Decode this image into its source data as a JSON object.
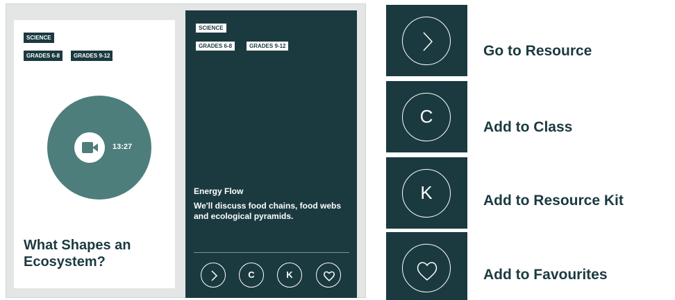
{
  "front_card": {
    "tags": {
      "subject": "SCIENCE",
      "grade_a": "GRADES 6-8",
      "grade_b": "GRADES 9-12"
    },
    "media_icon": "video-camera-icon",
    "duration": "13:27",
    "title": "What Shapes an Ecosystem?"
  },
  "back_card": {
    "tags": {
      "subject": "SCIENCE",
      "grade_a": "GRADES 6-8",
      "grade_b": "GRADES 9-12"
    },
    "title": "Energy Flow",
    "description": "We'll discuss food chains, food webs and ecological pyramids.",
    "actions": {
      "go": "chevron-right-icon",
      "class": "C",
      "kit": "K",
      "favourite": "heart-icon"
    }
  },
  "legend": {
    "items": [
      {
        "icon": "chevron-right-icon",
        "label": "Go to Resource"
      },
      {
        "icon": "C",
        "label": "Add to Class"
      },
      {
        "icon": "K",
        "label": "Add to Resource Kit"
      },
      {
        "icon": "heart-icon",
        "label": "Add to Favourites"
      }
    ]
  },
  "colors": {
    "primary": "#1b3a40",
    "accent": "#4d7e7c",
    "panel": "#e4e6e6"
  }
}
